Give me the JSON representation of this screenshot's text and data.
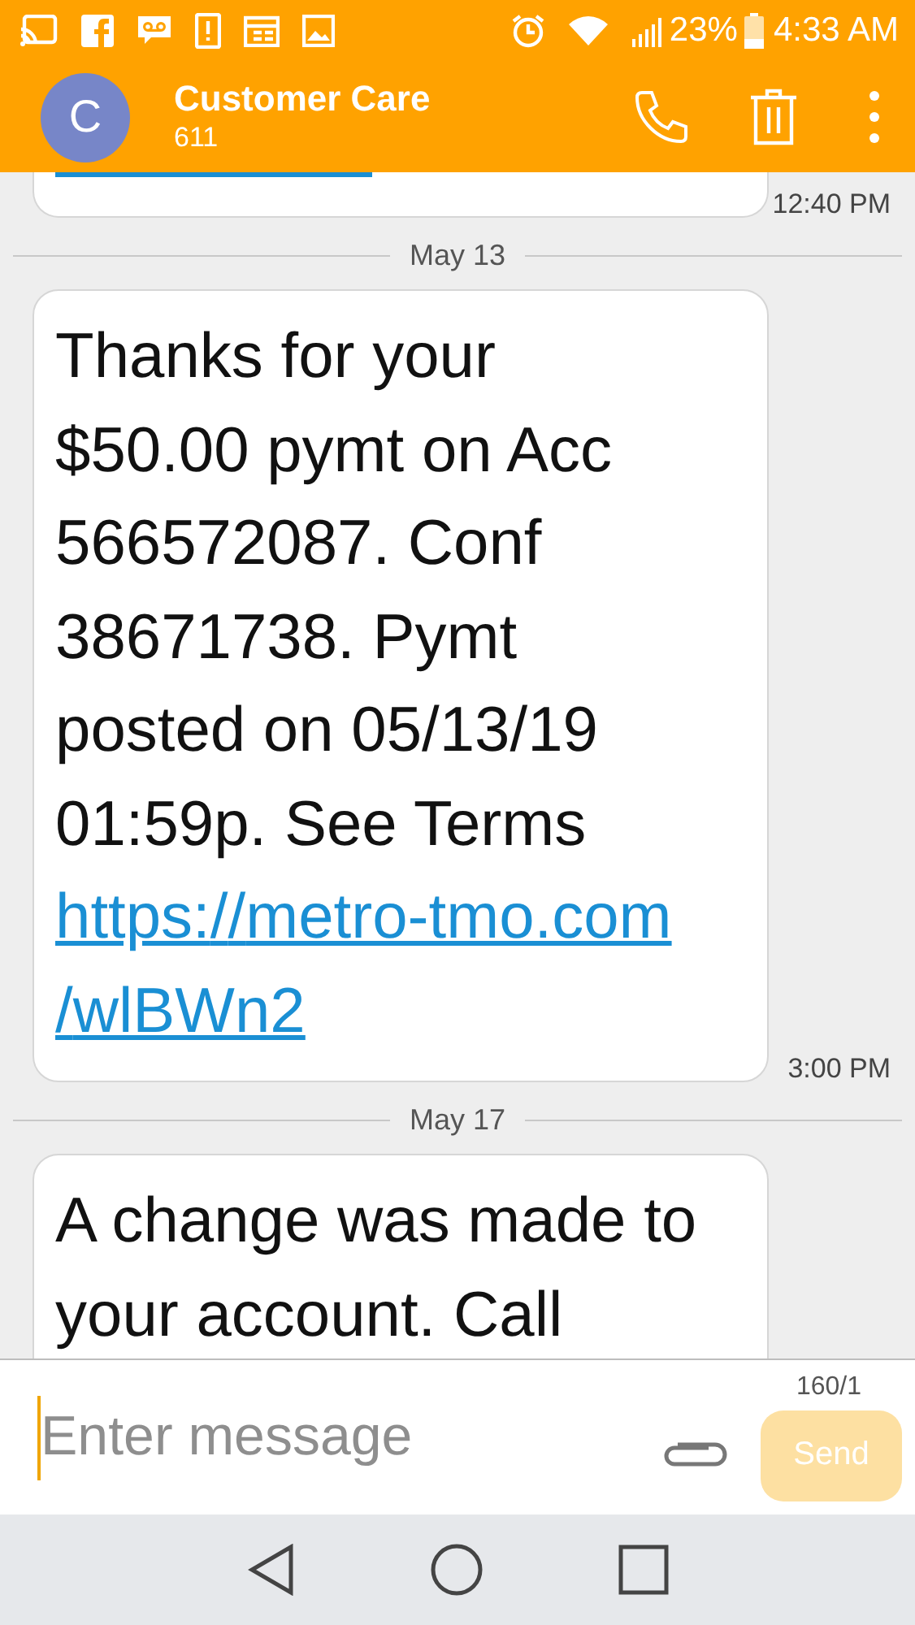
{
  "status_bar": {
    "battery": "23%",
    "time": "4:33 AM"
  },
  "contact": {
    "initial": "C",
    "name": "Customer Care",
    "number": "611"
  },
  "thread": [
    {
      "kind": "clipped",
      "time": "12:40 PM"
    },
    {
      "kind": "date",
      "label": "May 13"
    },
    {
      "kind": "message",
      "text": "Thanks for your $50.00 pymt on Acc 566572087. Conf 38671738. Pymt posted on 05/13/19 01:59p. See Terms",
      "link": "https://metro-tmo.com/wlBWn2",
      "time": "3:00 PM"
    },
    {
      "kind": "date",
      "label": "May 17"
    },
    {
      "kind": "message",
      "text": "A change was made to your account. Call"
    }
  ],
  "composer": {
    "placeholder": "Enter message",
    "counter": "160/1",
    "send": "Send",
    "send_disabled": true
  }
}
